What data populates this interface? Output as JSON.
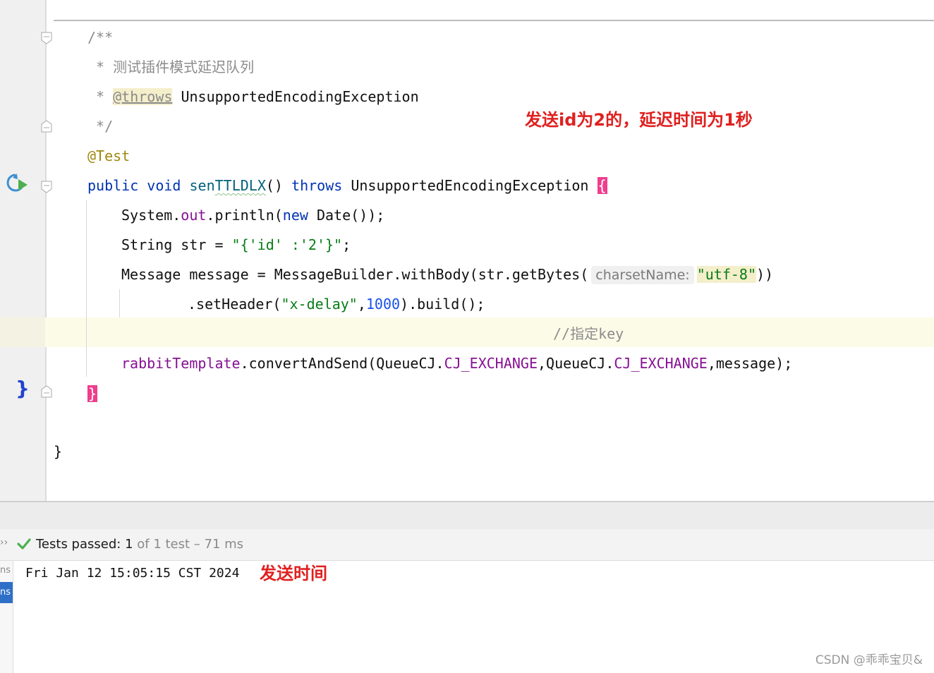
{
  "code": {
    "javadoc_open": "/**",
    "javadoc_desc": " * 测试插件模式延迟队列",
    "javadoc_star": " * ",
    "javadoc_tag": "@throws",
    "javadoc_tag_rest": " UnsupportedEncodingException",
    "javadoc_close": " */",
    "annotation": "@Test",
    "sig_public": "public",
    "sig_void": "void",
    "sig_name_prefix": "sen",
    "sig_name_rest": "TTLDLX",
    "sig_parens": "()",
    "sig_throws": "throws",
    "sig_exc": "UnsupportedEncodingException",
    "open_brace": "{",
    "l1_a": "System.",
    "l1_out": "out",
    "l1_b": ".println(",
    "l1_new": "new",
    "l1_c": " Date());",
    "l2_a": "String str = ",
    "l2_str": "\"{'id' :'2'}\"",
    "l2_b": ";",
    "l3_a": "Message message = MessageBuilder.withBody(str.getBytes(",
    "l3_hint": "charsetName:",
    "l3_str": "\"utf-8\"",
    "l3_b": "))",
    "l4_a": ".setHeader(",
    "l4_str": "\"x-delay\"",
    "l4_b": ",",
    "l4_num": "1000",
    "l4_c": ").build();",
    "l5_comment": "//指定key",
    "l6_field": "rabbitTemplate",
    "l6_a": ".convertAndSend(QueueCJ.",
    "l6_const1": "CJ_EXCHANGE",
    "l6_b": ",QueueCJ.",
    "l6_const2": "CJ_EXCHANGE",
    "l6_c": ",message);",
    "close_brace": "}",
    "class_close": "}"
  },
  "annotations": {
    "top_note": "发送id为2的，延迟时间为1秒",
    "bottom_note": "发送时间"
  },
  "tests": {
    "status_label": "Tests passed:",
    "passed_count": "1",
    "summary_rest": "of 1 test – 71 ms"
  },
  "console": {
    "output": "Fri Jan 12 15:05:15 CST 2024",
    "left_tab_1": "ns",
    "left_tab_2": "ns"
  },
  "watermark": "CSDN @乖乖宝贝&",
  "colors": {
    "keyword": "#0033b3",
    "string": "#067d17",
    "field": "#871094",
    "annotation_note": "#e02020",
    "brace_highlight": "#ee3f8e",
    "pass_check": "#4caf50"
  }
}
